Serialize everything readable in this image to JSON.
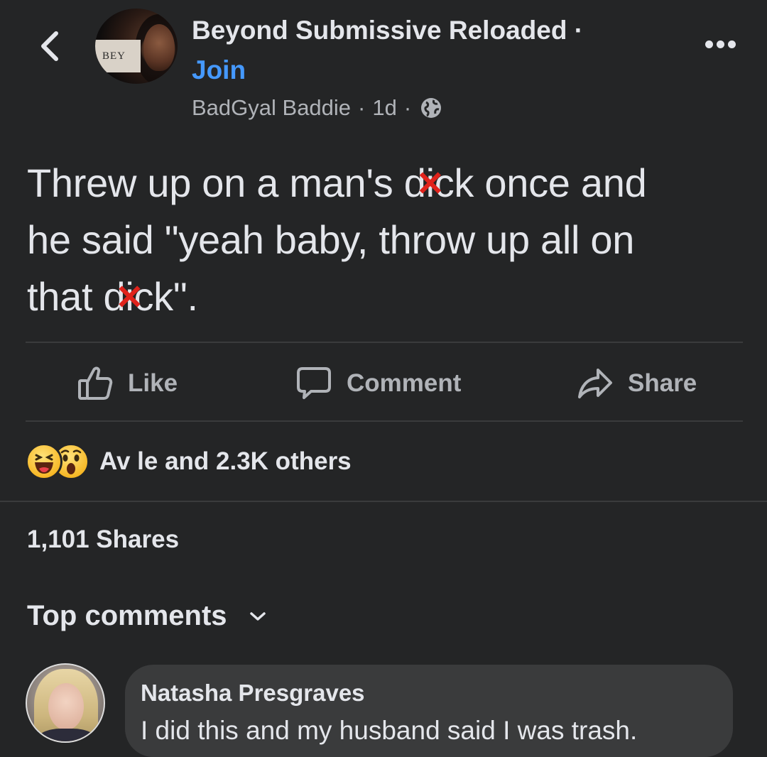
{
  "header": {
    "group_name": "Beyond Submissive Reloaded ·",
    "join_label": "Join",
    "author": "BadGyal Baddie",
    "separator": "·",
    "time": "1d",
    "avatar_text": "BEY"
  },
  "post": {
    "line1_before": "Threw up on a man's d",
    "line1_censored": "i",
    "line1_after": "ck once and",
    "line2": "he said \"yeah baby, throw up all on",
    "line3_before": "that d",
    "line3_censored": "i",
    "line3_after": "ck\".",
    "censor_mark": "✕"
  },
  "actions": {
    "like_label": "Like",
    "comment_label": "Comment",
    "share_label": "Share"
  },
  "reactions": {
    "summary": "Av le and 2.3K others"
  },
  "shares": {
    "label": "1,101 Shares"
  },
  "comments": {
    "section_label": "Top comments",
    "items": [
      {
        "author": "Natasha Presgraves",
        "text": "I did this and my husband said I was trash."
      }
    ]
  },
  "colors": {
    "background": "#242526",
    "text_primary": "#e4e6eb",
    "text_secondary": "#b0b3b8",
    "link": "#4599ff",
    "censor": "#e0231c",
    "reaction_yellow": "#f7b928",
    "bubble": "#3a3b3c"
  },
  "icons": {
    "back": "chevron-left-icon",
    "more": "more-options-icon",
    "globe": "globe-icon",
    "like": "thumbs-up-icon",
    "comment": "comment-bubble-icon",
    "share": "share-arrow-icon",
    "dropdown": "chevron-down-icon"
  }
}
